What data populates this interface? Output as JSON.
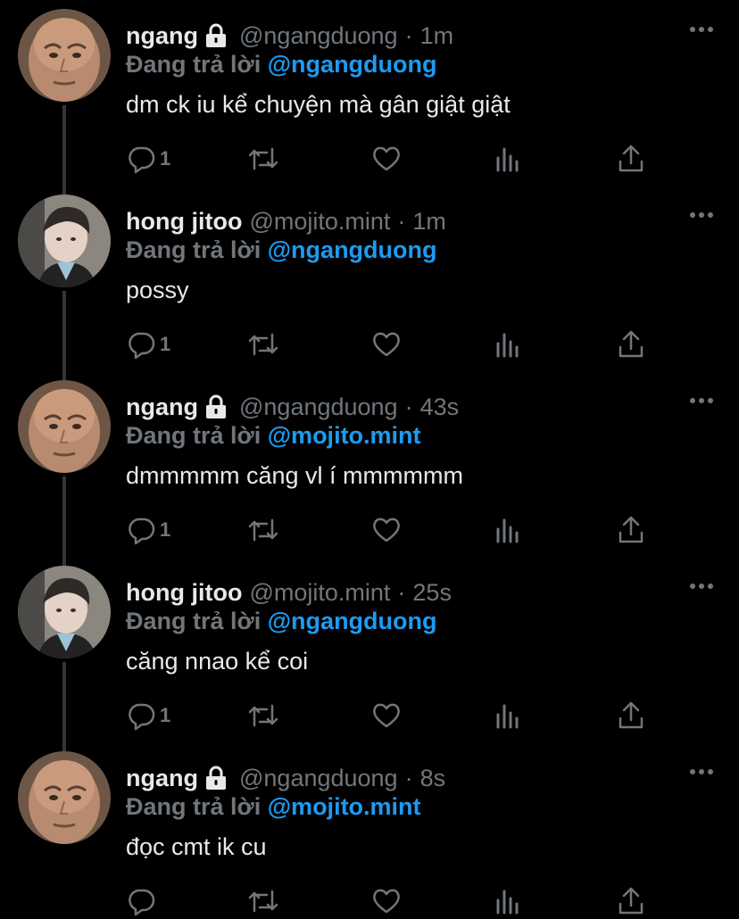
{
  "tweets": [
    {
      "name": "ngang",
      "handle": "@ngangduong",
      "time": "1m",
      "locked": true,
      "avatar": "rock-avatar",
      "reply_prefix": "Đang trả lời",
      "reply_to": "@ngangduong",
      "text": "dm ck iu kể chuyện mà gân giật giật",
      "reply_count": "1"
    },
    {
      "name": "hong jitoo",
      "handle": "@mojito.mint",
      "time": "1m",
      "locked": false,
      "avatar": "jitoo-avatar",
      "reply_prefix": "Đang trả lời",
      "reply_to": "@ngangduong",
      "text": "possy",
      "reply_count": "1"
    },
    {
      "name": "ngang",
      "handle": "@ngangduong",
      "time": "43s",
      "locked": true,
      "avatar": "rock-avatar",
      "reply_prefix": "Đang trả lời",
      "reply_to": "@mojito.mint",
      "text": "dmmmmm căng vl í mmmmmm",
      "reply_count": "1"
    },
    {
      "name": "hong jitoo",
      "handle": "@mojito.mint",
      "time": "25s",
      "locked": false,
      "avatar": "jitoo-avatar",
      "reply_prefix": "Đang trả lời",
      "reply_to": "@ngangduong",
      "text": "căng nnao kể coi",
      "reply_count": "1"
    },
    {
      "name": "ngang",
      "handle": "@ngangduong",
      "time": "8s",
      "locked": true,
      "avatar": "rock-avatar",
      "reply_prefix": "Đang trả lời",
      "reply_to": "@mojito.mint",
      "text": "đọc cmt ik cu",
      "reply_count": ""
    }
  ],
  "icons": {
    "more": "more-icon",
    "reply": "reply-icon",
    "retweet": "retweet-icon",
    "like": "heart-icon",
    "views": "views-icon",
    "share": "share-icon",
    "lock": "lock-icon"
  },
  "colors": {
    "background": "#000000",
    "text": "#e7e9ea",
    "muted": "#71767b",
    "mention": "#1d9bf0",
    "thread_line": "#333639"
  }
}
